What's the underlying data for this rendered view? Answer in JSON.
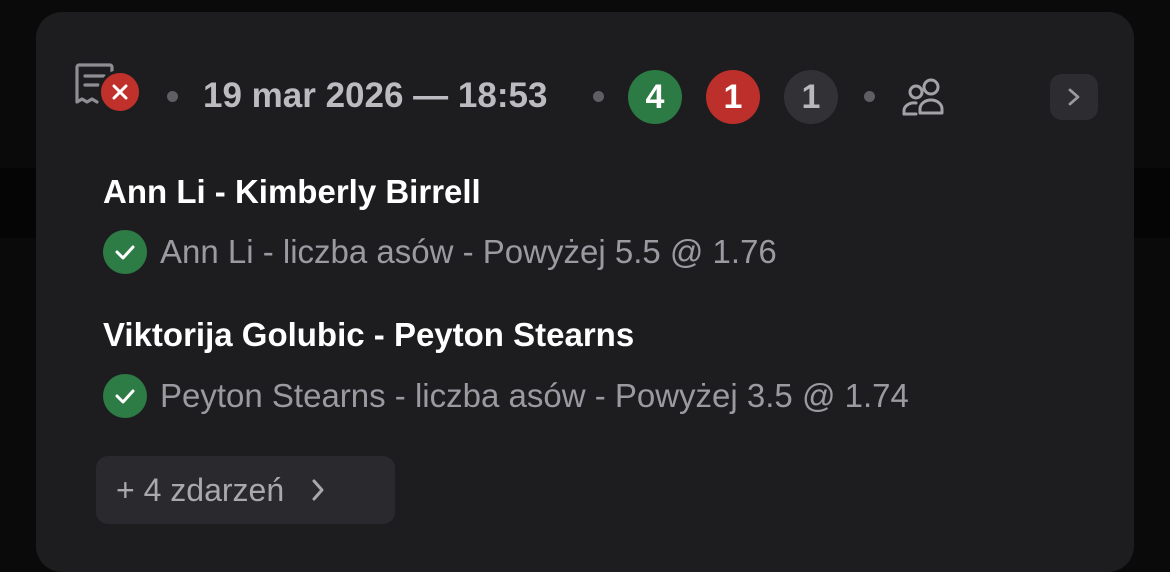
{
  "header": {
    "date_time": "19 mar 2026 — 18:53",
    "counts": {
      "won": "4",
      "lost": "1",
      "open": "1"
    },
    "icons": {
      "ticket": "ticket-icon",
      "status": "close-icon",
      "people": "people-icon",
      "expand": "chevron-right-icon"
    }
  },
  "events": [
    {
      "match": "Ann Li - Kimberly Birrell",
      "bet": "Ann Li - liczba asów - Powyżej 5.5 @ 1.76",
      "status": "won"
    },
    {
      "match": "Viktorija Golubic - Peyton Stearns",
      "bet": "Peyton Stearns - liczba asów - Powyżej 3.5 @ 1.74",
      "status": "won"
    }
  ],
  "more": {
    "label": "+ 4 zdarzeń"
  },
  "colors": {
    "card_bg": "#1d1d1f",
    "won": "#2c7a44",
    "lost": "#bd2f2a",
    "neutral": "#323236",
    "text_primary": "#ffffff",
    "text_secondary": "#9a9aa0"
  }
}
